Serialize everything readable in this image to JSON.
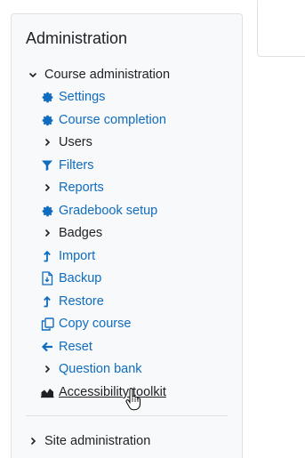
{
  "block": {
    "title": "Administration"
  },
  "course_admin": {
    "label": "Course administration",
    "items": [
      {
        "label": "Settings",
        "icon": "gear-icon"
      },
      {
        "label": "Course completion",
        "icon": "gear-icon"
      },
      {
        "label": "Users",
        "icon": "chevron-right-icon"
      },
      {
        "label": "Filters",
        "icon": "filter-icon"
      },
      {
        "label": "Reports",
        "icon": "chevron-right-icon"
      },
      {
        "label": "Gradebook setup",
        "icon": "gear-icon"
      },
      {
        "label": "Badges",
        "icon": "chevron-right-icon"
      },
      {
        "label": "Import",
        "icon": "upload-arrow-icon"
      },
      {
        "label": "Backup",
        "icon": "backup-file-icon"
      },
      {
        "label": "Restore",
        "icon": "upload-arrow-icon"
      },
      {
        "label": "Copy course",
        "icon": "copy-icon"
      },
      {
        "label": "Reset",
        "icon": "arrow-left-icon"
      },
      {
        "label": "Question bank",
        "icon": "chevron-right-icon"
      },
      {
        "label": "Accessibility toolkit",
        "icon": "area-chart-icon"
      }
    ]
  },
  "site_admin": {
    "label": "Site administration"
  },
  "right_card": {
    "fragment": "ʻ"
  },
  "colors": {
    "link": "#0f6cbf",
    "text": "#1d2125",
    "block_bg": "#f8f9fa",
    "border": "#dee2e6"
  }
}
